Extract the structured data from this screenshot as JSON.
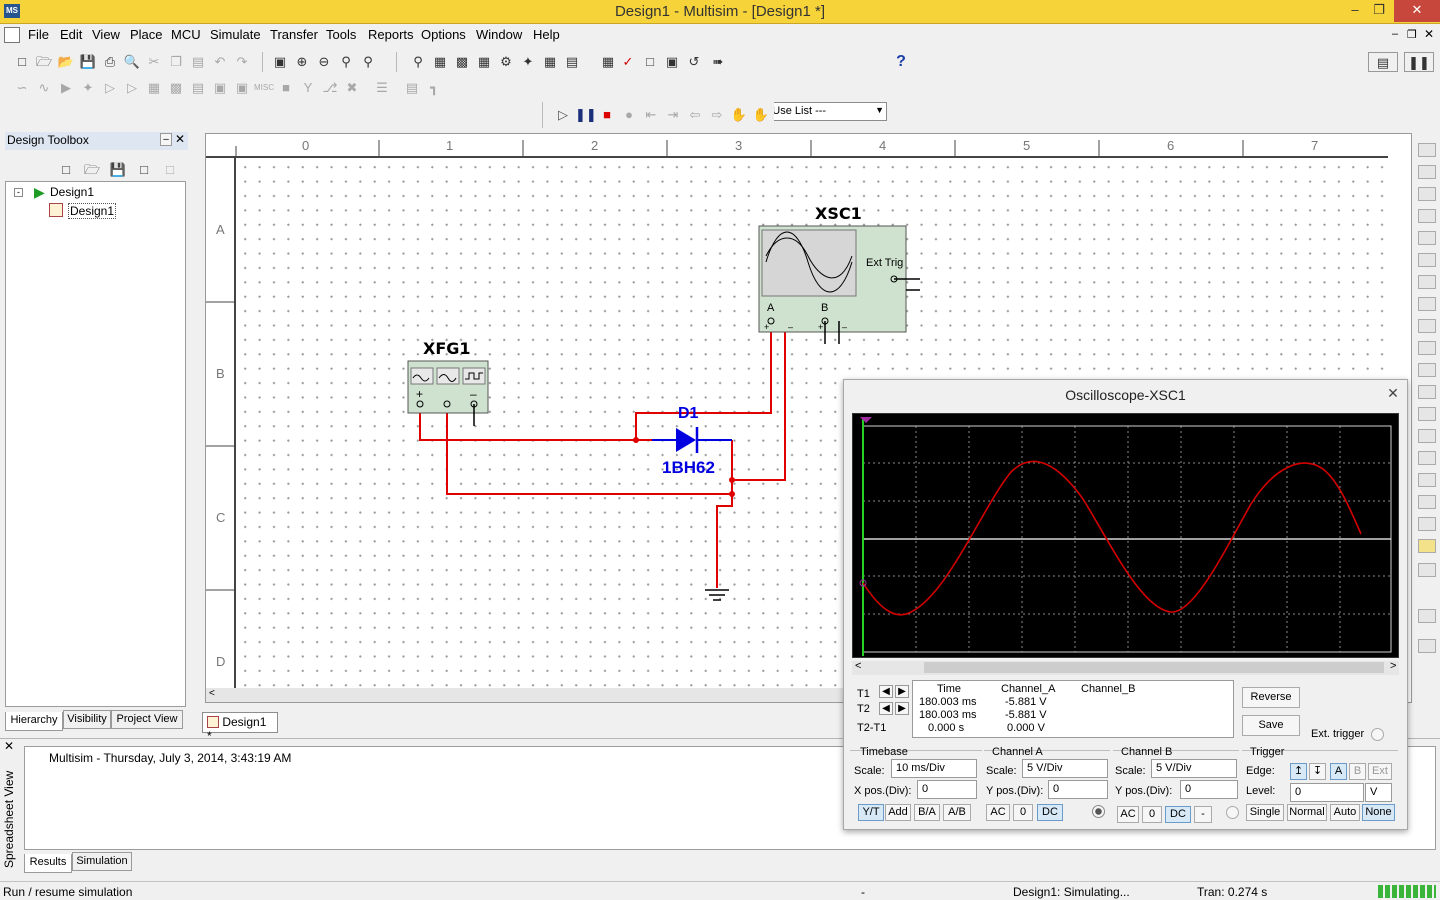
{
  "window": {
    "title": "Design1 - Multisim - [Design1 *]",
    "app_icon": "multisim-icon"
  },
  "menu": [
    "File",
    "Edit",
    "View",
    "Place",
    "MCU",
    "Simulate",
    "Transfer",
    "Tools",
    "Reports",
    "Options",
    "Window",
    "Help"
  ],
  "toolbar": {
    "in_use_list": "--- In Use List ---",
    "help": "?"
  },
  "design_toolbox": {
    "title": "Design Toolbox",
    "tree": {
      "root": "Design1",
      "child": "Design1"
    },
    "tabs": [
      "Hierarchy",
      "Visibility",
      "Project View"
    ]
  },
  "canvas": {
    "ruler_columns": [
      "0",
      "1",
      "2",
      "3",
      "4",
      "5",
      "6",
      "7"
    ],
    "ruler_rows": [
      "A",
      "B",
      "C",
      "D"
    ],
    "doc_tab": "Design1 *"
  },
  "components": {
    "function_generator": {
      "ref": "XFG1"
    },
    "oscilloscope": {
      "ref": "XSC1",
      "ext_trig": "Ext Trig",
      "ch_a": "A",
      "ch_b": "B"
    },
    "diode": {
      "ref": "D1",
      "part": "1BH62"
    }
  },
  "scope": {
    "title": "Oscilloscope-XSC1",
    "readout": {
      "headers": [
        "Time",
        "Channel_A",
        "Channel_B"
      ],
      "rows": [
        {
          "label": "T1",
          "time": "180.003 ms",
          "cha": "-5.881 V",
          "chb": ""
        },
        {
          "label": "T2",
          "time": "180.003 ms",
          "cha": "-5.881 V",
          "chb": ""
        },
        {
          "label": "T2-T1",
          "time": "0.000 s",
          "cha": "0.000 V",
          "chb": ""
        }
      ]
    },
    "buttons": {
      "reverse": "Reverse",
      "save": "Save",
      "ext_trigger": "Ext. trigger"
    },
    "timebase": {
      "title": "Timebase",
      "scale_label": "Scale:",
      "scale": "10 ms/Div",
      "xpos_label": "X pos.(Div):",
      "xpos": "0",
      "modes": [
        "Y/T",
        "Add",
        "B/A",
        "A/B"
      ]
    },
    "channel_a": {
      "title": "Channel A",
      "scale_label": "Scale:",
      "scale": "5  V/Div",
      "ypos_label": "Y pos.(Div):",
      "ypos": "0",
      "coupling": [
        "AC",
        "0",
        "DC"
      ]
    },
    "channel_b": {
      "title": "Channel B",
      "scale_label": "Scale:",
      "scale": "5  V/Div",
      "ypos_label": "Y pos.(Div):",
      "ypos": "0",
      "coupling": [
        "AC",
        "0",
        "DC",
        "-"
      ]
    },
    "trigger": {
      "title": "Trigger",
      "edge_label": "Edge:",
      "edge_sources": [
        "A",
        "B",
        "Ext"
      ],
      "level_label": "Level:",
      "level": "0",
      "level_unit": "V",
      "modes": [
        "Single",
        "Normal",
        "Auto",
        "None"
      ]
    }
  },
  "spreadsheet": {
    "side_label": "Spreadsheet View",
    "message": "Multisim  -  Thursday, July 3, 2014, 3:43:19 AM",
    "tabs": [
      "Results",
      "Simulation"
    ]
  },
  "status": {
    "left": "Run / resume simulation",
    "mid": "-",
    "state": "Design1: Simulating...",
    "tran": "Tran: 0.274 s"
  },
  "colors": {
    "title_bar": "#f7d33a",
    "wire": "#e00000",
    "diode": "#0000e0",
    "trace_a": "#d40000",
    "trace_b": "#ffffff",
    "instrument": "#cfe2cf"
  }
}
